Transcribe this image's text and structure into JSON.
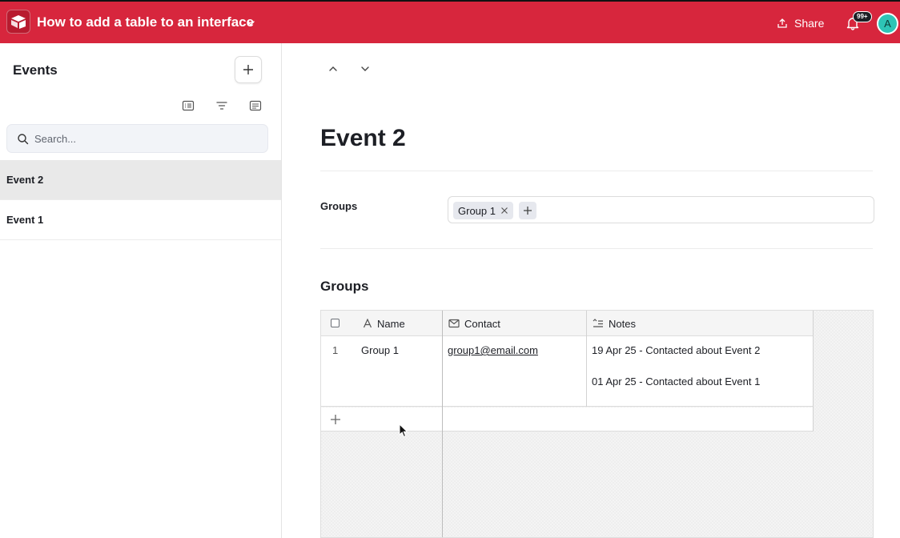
{
  "app": {
    "title": "How to add a table to an interface",
    "share_label": "Share",
    "notification_count": "99+",
    "avatar_initial": "A",
    "brand_color": "#d7263d"
  },
  "sidebar": {
    "title": "Events",
    "search_placeholder": "Search...",
    "items": [
      {
        "label": "Event 2",
        "selected": true
      },
      {
        "label": "Event 1",
        "selected": false
      }
    ],
    "toolbar_icons": [
      "list-view-icon",
      "filter-icon",
      "settings-list-icon"
    ]
  },
  "record": {
    "title": "Event 2",
    "fields": {
      "groups_label": "Groups",
      "groups_chip": "Group 1"
    }
  },
  "table": {
    "title": "Groups",
    "columns": [
      "Name",
      "Contact",
      "Notes"
    ],
    "rows": [
      {
        "num": "1",
        "name": "Group 1",
        "contact": "group1@email.com",
        "notes": [
          "19 Apr 25 - Contacted about Event 2",
          "01 Apr 25 - Contacted about Event 1"
        ]
      }
    ]
  }
}
